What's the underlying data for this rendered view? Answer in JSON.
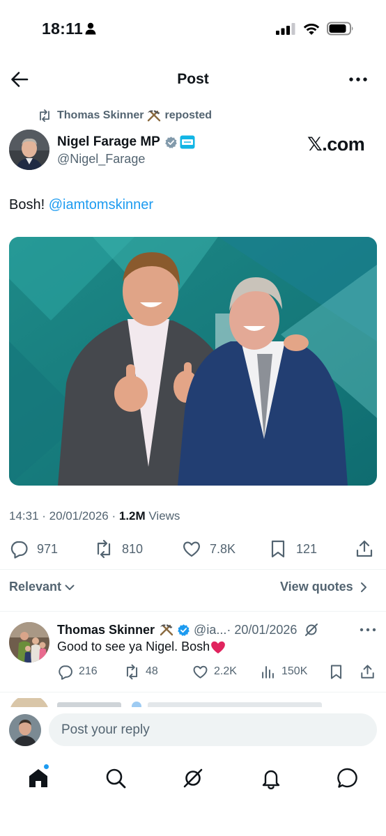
{
  "status_bar": {
    "time": "18:11"
  },
  "header": {
    "title": "Post"
  },
  "repost": {
    "reposted_by": "Thomas Skinner",
    "label": "reposted"
  },
  "author": {
    "name": "Nigel Farage MP",
    "handle": "@Nigel_Farage"
  },
  "watermark": "𝕏.com",
  "tweet": {
    "text": "Bosh! ",
    "mention": "@iamtomskinner",
    "time": "14:31",
    "date": "20/01/2026",
    "views_count": "1.2M",
    "views_label": " Views",
    "sep": " · "
  },
  "actions": {
    "replies": "971",
    "reposts": "810",
    "likes": "7.8K",
    "bookmarks": "121"
  },
  "sort": {
    "label": "Relevant",
    "view_quotes": "View quotes"
  },
  "reply": {
    "name": "Thomas Skinner",
    "handle": "@ia...",
    "date": " · 20/01/2026",
    "text": "Good to see ya Nigel. Bosh",
    "replies": "216",
    "reposts": "48",
    "likes": "2.2K",
    "views": "150K"
  },
  "composer": {
    "placeholder": "Post your reply"
  },
  "colors": {
    "accent": "#1d9bf0",
    "secondary_text": "#536471",
    "like_heart": "#e0245e"
  }
}
